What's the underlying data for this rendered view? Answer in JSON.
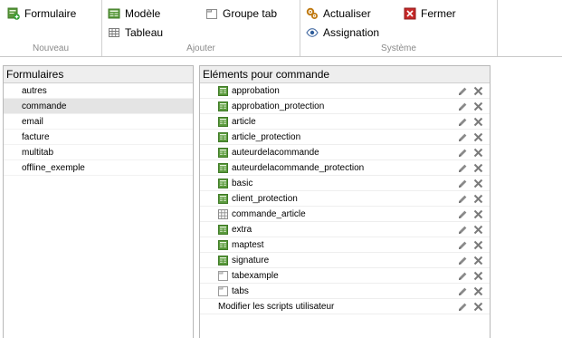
{
  "ribbon": {
    "nouveau": {
      "label": "Nouveau",
      "buttons": {
        "formulaire": "Formulaire"
      }
    },
    "ajouter": {
      "label": "Ajouter",
      "buttons": {
        "modele": "Modèle",
        "tableau": "Tableau",
        "groupe_tab": "Groupe tab"
      }
    },
    "systeme": {
      "label": "Système",
      "buttons": {
        "actualiser": "Actualiser",
        "fermer": "Fermer",
        "assignation": "Assignation"
      }
    }
  },
  "forms_panel": {
    "title": "Formulaires",
    "items": [
      "autres",
      "commande",
      "email",
      "facture",
      "multitab",
      "offline_exemple"
    ],
    "selected_index": 1
  },
  "elements_panel": {
    "title": "Eléments pour commande",
    "items": [
      {
        "label": "approbation",
        "icon": "model-icon"
      },
      {
        "label": "approbation_protection",
        "icon": "model-icon"
      },
      {
        "label": "article",
        "icon": "model-icon"
      },
      {
        "label": "article_protection",
        "icon": "model-icon"
      },
      {
        "label": "auteurdelacommande",
        "icon": "model-icon"
      },
      {
        "label": "auteurdelacommande_protection",
        "icon": "model-icon"
      },
      {
        "label": "basic",
        "icon": "model-icon"
      },
      {
        "label": "client_protection",
        "icon": "model-icon"
      },
      {
        "label": "commande_article",
        "icon": "table-icon"
      },
      {
        "label": "extra",
        "icon": "model-icon"
      },
      {
        "label": "maptest",
        "icon": "model-icon"
      },
      {
        "label": "signature",
        "icon": "model-icon"
      },
      {
        "label": "tabexample",
        "icon": "tab-group-icon"
      },
      {
        "label": "tabs",
        "icon": "tab-group-icon"
      },
      {
        "label": "Modifier les scripts utilisateur",
        "icon": ""
      }
    ]
  },
  "colors": {
    "ribbon_group_label": "#8a8a8a",
    "selected_row": "#e4e4e4",
    "panel_header": "#eeeeee",
    "model_icon_green": "#5a9a3c",
    "close_red": "#c62828"
  }
}
